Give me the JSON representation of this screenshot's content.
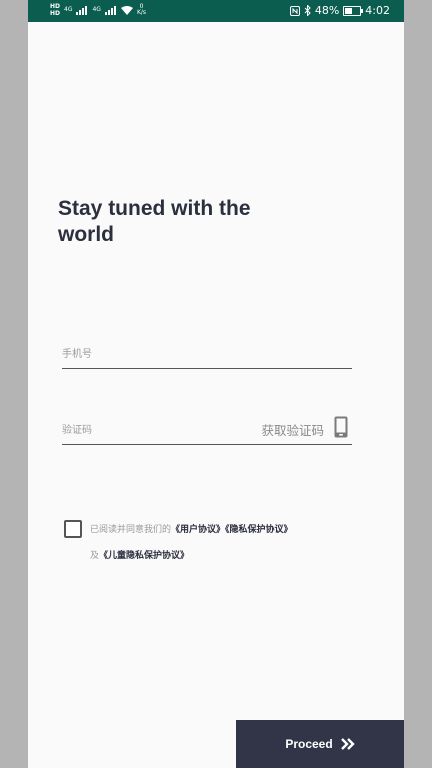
{
  "status_bar": {
    "sim1": "HD",
    "sim2": "HD",
    "network1": "4G",
    "network2": "4G",
    "speed_value": "0",
    "speed_unit": "K/s",
    "battery": "48%",
    "time": "4:02"
  },
  "headline": "Stay tuned with the world",
  "phone_field": {
    "placeholder": "手机号",
    "value": ""
  },
  "code_field": {
    "placeholder": "验证码",
    "value": ""
  },
  "get_code_label": "获取验证码",
  "agreement": {
    "checked": false,
    "prefix": "已阅读并同意我们的",
    "user_agreement": "《用户协议》",
    "privacy_policy": "《隐私保护协议》",
    "and": "及",
    "children_privacy": "《儿童隐私保护协议》"
  },
  "proceed_label": "Proceed",
  "colors": {
    "status_bar": "#0b5e4f",
    "headline": "#2c2f3e",
    "proceed_bg": "#323547",
    "background": "#fafafa"
  },
  "icons": [
    "nfc-icon",
    "bluetooth-icon",
    "battery-icon",
    "phone-icon",
    "double-chevron-right-icon"
  ]
}
